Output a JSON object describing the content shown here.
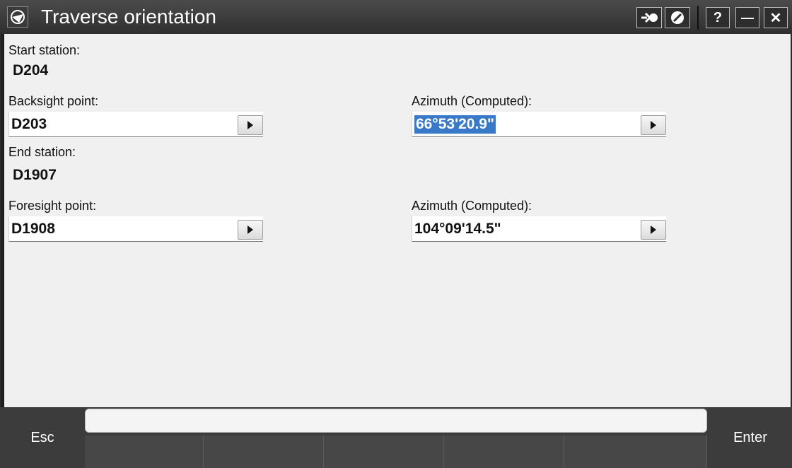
{
  "window": {
    "title": "Traverse orientation"
  },
  "titlebar_buttons": {
    "help_label": "?",
    "minimize_label": "—",
    "close_label": "✕"
  },
  "start_station": {
    "label": "Start station:",
    "value": "D204"
  },
  "backsight": {
    "label": "Backsight point:",
    "value": "D203"
  },
  "backsight_azimuth": {
    "label": "Azimuth (Computed):",
    "value": "66°53'20.9\""
  },
  "end_station": {
    "label": "End station:",
    "value": "D1907"
  },
  "foresight": {
    "label": "Foresight point:",
    "value": "D1908"
  },
  "foresight_azimuth": {
    "label": "Azimuth (Computed):",
    "value": "104°09'14.5\""
  },
  "softkeys": {
    "esc_label": "Esc",
    "enter_label": "Enter"
  },
  "icons": [
    "logo-icon",
    "switch-to-icon",
    "no-entry-icon",
    "help-icon",
    "minimize-icon",
    "close-icon",
    "arrow-right-icon"
  ]
}
